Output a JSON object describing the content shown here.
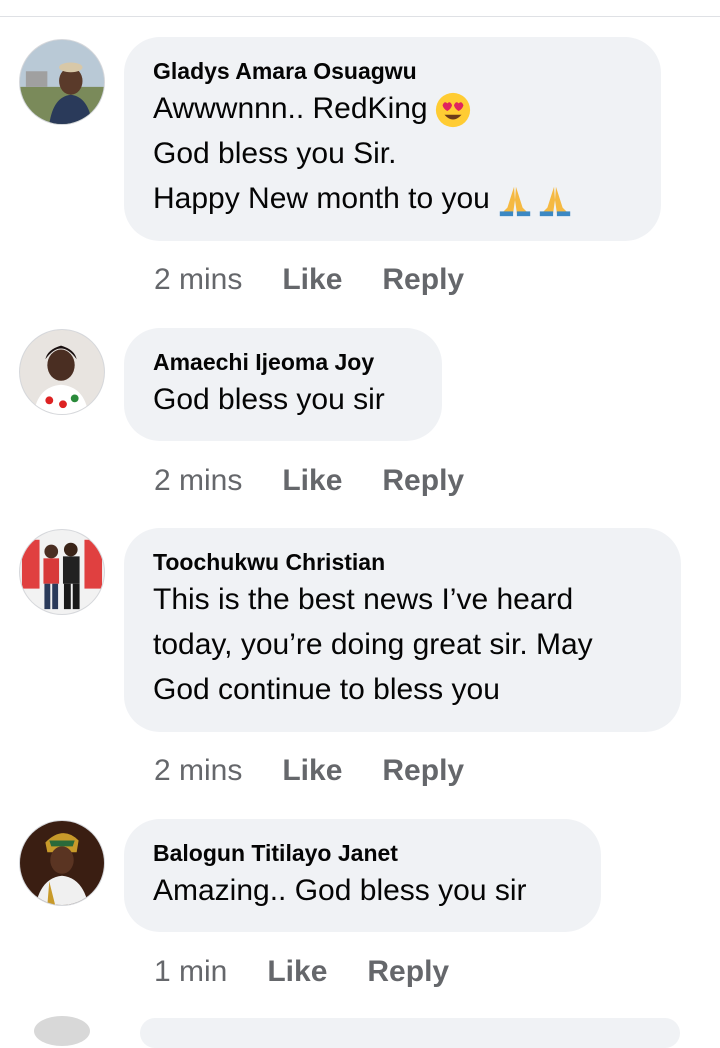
{
  "comments": [
    {
      "author": "Gladys Amara Osuagwu",
      "lines": [
        "Awwwnnn.. RedKing",
        "God bless you Sir.",
        "Happy New month to you"
      ],
      "line_emojis": [
        "heart-eyes-emoji",
        "",
        "folded-hands-emoji x2"
      ],
      "time": "2 mins",
      "like": "Like",
      "reply": "Reply"
    },
    {
      "author": "Amaechi Ijeoma Joy",
      "lines": [
        "God bless you sir"
      ],
      "time": "2 mins",
      "like": "Like",
      "reply": "Reply"
    },
    {
      "author": "Toochukwu Christian",
      "lines": [
        "This is the best news I’ve heard",
        "today, you’re doing great sir. May",
        "God continue to bless you"
      ],
      "time": "2 mins",
      "like": "Like",
      "reply": "Reply"
    },
    {
      "author": "Balogun Titilayo Janet",
      "lines": [
        "Amazing.. God bless you sir"
      ],
      "time": "1 min",
      "like": "Like",
      "reply": "Reply"
    }
  ],
  "colors": {
    "bubble_bg": "#f0f2f5",
    "text": "#050505",
    "secondary_text": "#65676b"
  }
}
